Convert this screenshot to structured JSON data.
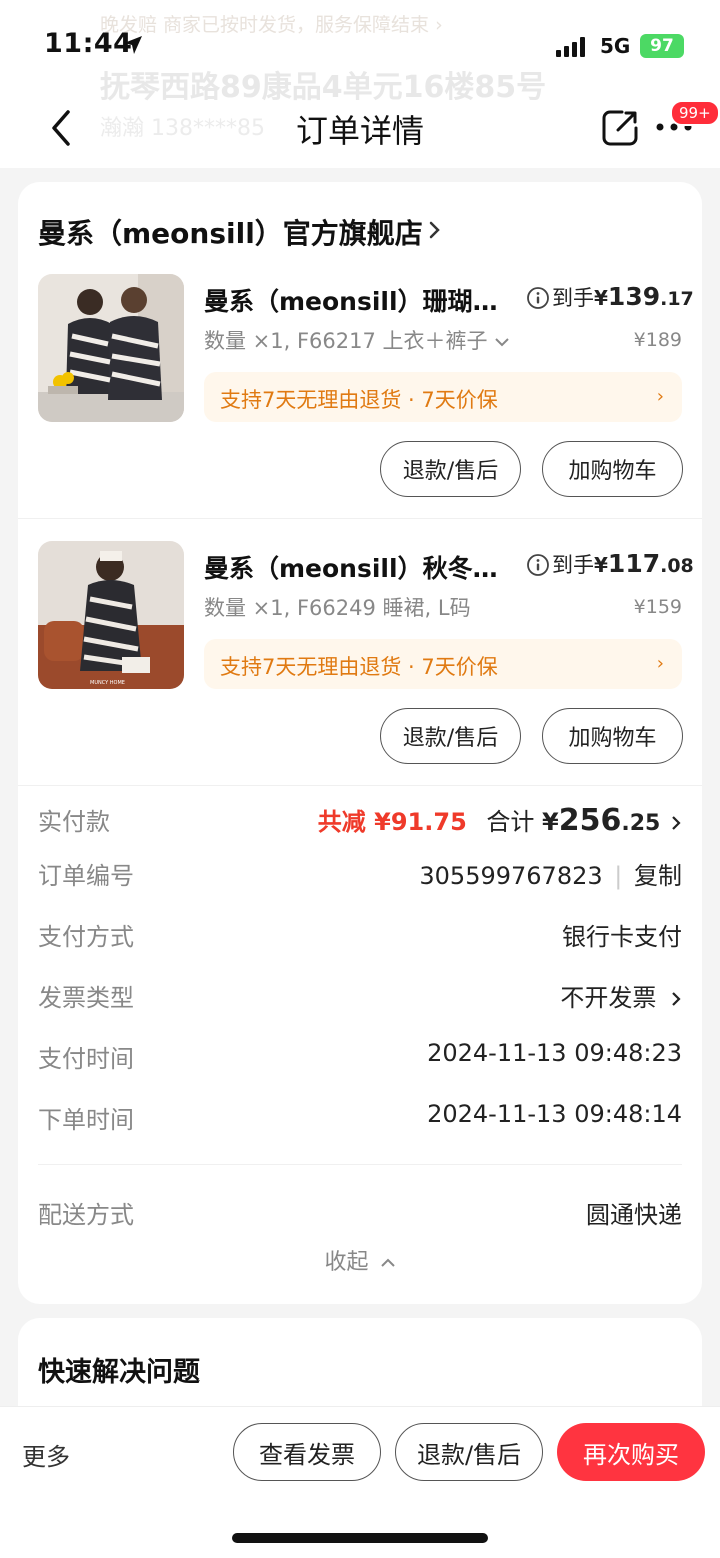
{
  "status_bar": {
    "time": "11:44",
    "network": "5G",
    "battery": "97"
  },
  "header_background": {
    "notice": "晚发赔  商家已按时发货，服务保障结束 ›",
    "address": "抚琴西路89康品4单元16楼85号",
    "contact": "瀚瀚  138****85"
  },
  "nav": {
    "title": "订单详情",
    "badge": "99+"
  },
  "order": {
    "shop_name": "曼系（meonsill）官方旗舰店",
    "items": [
      {
        "name": "曼系（meonsill）珊瑚…",
        "price_label": "到手",
        "price_symbol": "¥",
        "price_int": "139",
        "price_dec": ".17",
        "spec": "数量 ×1, F66217 上衣＋裤子",
        "original_price": "¥189",
        "promise": "支持7天无理由退货 · 7天价保",
        "btn_refund": "退款/售后",
        "btn_cart": "加购物车"
      },
      {
        "name": "曼系（meonsill）秋冬…",
        "price_label": "到手",
        "price_symbol": "¥",
        "price_int": "117",
        "price_dec": ".08",
        "spec": "数量 ×1, F66249 睡裙, L码",
        "original_price": "¥159",
        "promise": "支持7天无理由退货 · 7天价保",
        "btn_refund": "退款/售后",
        "btn_cart": "加购物车"
      }
    ],
    "payment": {
      "label": "实付款",
      "discount": "共减 ¥91.75",
      "total_label": "合计",
      "total_symbol": "¥",
      "total_int": "256",
      "total_dec": ".25"
    },
    "order_no": {
      "label": "订单编号",
      "value": "305599767823",
      "copy": "复制"
    },
    "pay_method": {
      "label": "支付方式",
      "value": "银行卡支付"
    },
    "invoice_type": {
      "label": "发票类型",
      "value": "不开发票"
    },
    "pay_time": {
      "label": "支付时间",
      "value": "2024-11-13 09:48:23"
    },
    "order_time": {
      "label": "下单时间",
      "value": "2024-11-13 09:48:14"
    },
    "delivery": {
      "label": "配送方式",
      "value": "圆通快递"
    },
    "collapse": "收起"
  },
  "quick": {
    "title": "快速解决问题"
  },
  "bottom_bar": {
    "more": "更多",
    "view_invoice": "查看发票",
    "refund": "退款/售后",
    "rebuy": "再次购买"
  },
  "colors": {
    "accent": "#ff3440",
    "discount": "#ef3a2a",
    "promise_text": "#e07a12",
    "promise_bg": "#fff7ec"
  }
}
